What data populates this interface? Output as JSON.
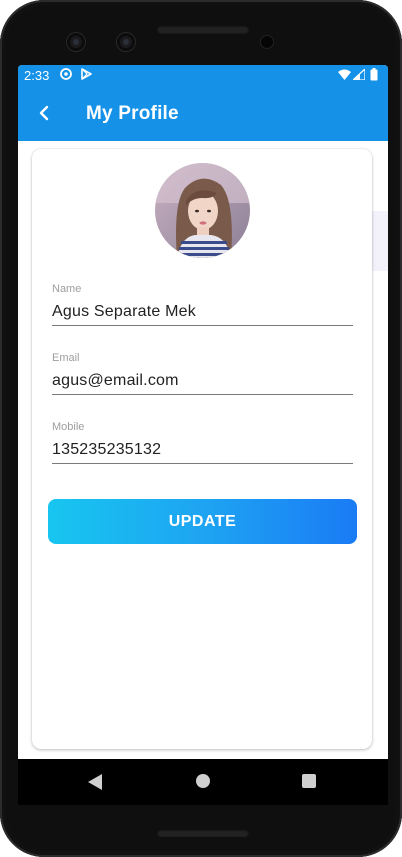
{
  "status_bar": {
    "time": "2:33",
    "icons": [
      "notification-ring-icon",
      "play-store-icon",
      "wifi-icon",
      "signal-icon",
      "battery-icon"
    ]
  },
  "app_bar": {
    "title": "My Profile",
    "back_icon": "chevron-left-icon",
    "color": "#1592e8"
  },
  "profile": {
    "avatar": "profile-photo",
    "fields": {
      "name": {
        "label": "Name",
        "value": "Agus Separate Mek"
      },
      "email": {
        "label": "Email",
        "value": "agus@email.com"
      },
      "mobile": {
        "label": "Mobile",
        "value": "135235235132"
      }
    },
    "update_button": {
      "label": "UPDATE",
      "gradient": [
        "#17c6f0",
        "#1a7bf5"
      ]
    }
  },
  "nav_bar": {
    "buttons": [
      "back-triangle-icon",
      "home-circle-icon",
      "recents-square-icon"
    ]
  }
}
